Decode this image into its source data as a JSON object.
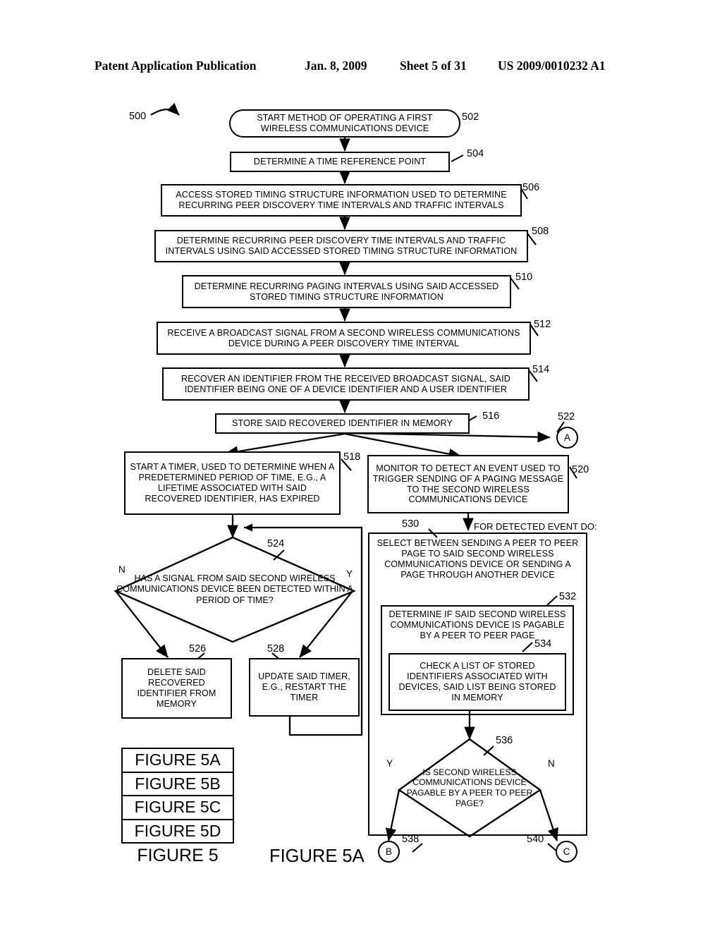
{
  "header": {
    "publication": "Patent Application Publication",
    "date": "Jan. 8, 2009",
    "sheet": "Sheet 5 of 31",
    "number": "US 2009/0010232 A1"
  },
  "figure": {
    "flow_ref": "500",
    "caption_main": "FIGURE 5A",
    "legend_caption": "FIGURE 5",
    "legend_rows": [
      "FIGURE 5A",
      "FIGURE 5B",
      "FIGURE 5C",
      "FIGURE 5D"
    ],
    "annotation_for_detected_event": "FOR DETECTED EVENT DO:"
  },
  "nodes": [
    {
      "ref": "502",
      "shape": "terminator",
      "text": "START METHOD OF OPERATING A FIRST WIRELESS COMMUNICATIONS DEVICE"
    },
    {
      "ref": "504",
      "shape": "process",
      "text": "DETERMINE A TIME REFERENCE POINT"
    },
    {
      "ref": "506",
      "shape": "process",
      "text": "ACCESS STORED TIMING STRUCTURE INFORMATION USED TO DETERMINE RECURRING PEER DISCOVERY TIME INTERVALS AND TRAFFIC INTERVALS"
    },
    {
      "ref": "508",
      "shape": "process",
      "text": "DETERMINE RECURRING PEER DISCOVERY TIME INTERVALS AND TRAFFIC INTERVALS USING SAID ACCESSED STORED TIMING STRUCTURE INFORMATION"
    },
    {
      "ref": "510",
      "shape": "process",
      "text": "DETERMINE RECURRING PAGING INTERVALS USING SAID ACCESSED STORED TIMING STRUCTURE INFORMATION"
    },
    {
      "ref": "512",
      "shape": "process",
      "text": "RECEIVE A BROADCAST SIGNAL FROM A SECOND WIRELESS COMMUNICATIONS DEVICE DURING A PEER DISCOVERY TIME INTERVAL"
    },
    {
      "ref": "514",
      "shape": "process",
      "text": "RECOVER AN IDENTIFIER FROM THE RECEIVED BROADCAST SIGNAL, SAID IDENTIFIER BEING ONE OF A DEVICE IDENTIFIER AND A USER IDENTIFIER"
    },
    {
      "ref": "516",
      "shape": "process",
      "text": "STORE SAID RECOVERED IDENTIFIER IN MEMORY"
    },
    {
      "ref": "518",
      "shape": "process",
      "text": "START A TIMER, USED TO DETERMINE WHEN A PREDETERMINED PERIOD OF TIME, E.G., A LIFETIME ASSOCIATED WITH SAID RECOVERED IDENTIFIER, HAS EXPIRED"
    },
    {
      "ref": "520",
      "shape": "process",
      "text": "MONITOR TO DETECT AN EVENT USED TO TRIGGER SENDING OF A PAGING MESSAGE TO THE SECOND WIRELESS COMMUNICATIONS DEVICE"
    },
    {
      "ref": "522",
      "shape": "connector",
      "text": "A"
    },
    {
      "ref": "524",
      "shape": "decision",
      "text": "HAS A SIGNAL FROM SAID SECOND WIRELESS COMMUNICATIONS DEVICE BEEN DETECTED WITHIN A PERIOD OF TIME?",
      "branch_left": "N",
      "branch_right": "Y"
    },
    {
      "ref": "526",
      "shape": "process",
      "text": "DELETE SAID RECOVERED IDENTIFIER FROM MEMORY"
    },
    {
      "ref": "528",
      "shape": "process",
      "text": "UPDATE SAID TIMER, E.G., RESTART THE TIMER"
    },
    {
      "ref": "530",
      "shape": "process",
      "text": "SELECT BETWEEN SENDING A PEER TO PEER PAGE TO SAID SECOND WIRELESS COMMUNICATIONS DEVICE OR SENDING A PAGE THROUGH ANOTHER DEVICE"
    },
    {
      "ref": "532",
      "shape": "process",
      "text": "DETERMINE IF SAID SECOND WIRELESS COMMUNICATIONS DEVICE IS PAGABLE BY A PEER TO PEER PAGE"
    },
    {
      "ref": "534",
      "shape": "process",
      "text": "CHECK A LIST OF STORED IDENTIFIERS ASSOCIATED WITH DEVICES, SAID LIST BEING STORED IN MEMORY"
    },
    {
      "ref": "536",
      "shape": "decision",
      "text": "IS SECOND WIRELESS COMMUNICATIONS DEVICE PAGABLE BY A PEER TO PEER PAGE?",
      "branch_left": "Y",
      "branch_right": "N"
    },
    {
      "ref": "538",
      "shape": "connector",
      "text": "B"
    },
    {
      "ref": "540",
      "shape": "connector",
      "text": "C"
    }
  ]
}
